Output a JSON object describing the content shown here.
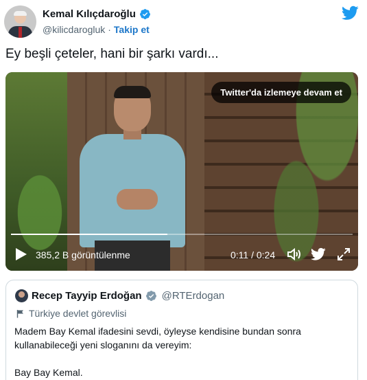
{
  "tweet": {
    "author_name": "Kemal Kılıçdaroğlu",
    "author_handle": "@kilicdarogluk",
    "separator": "·",
    "follow_label": "Takip et",
    "text": "Ey beşli çeteler, hani bir şarkı vardı..."
  },
  "video": {
    "continue_label": "Twitter'da izlemeye devam et",
    "views": "385,2 B görüntülenme",
    "time": "0:11 / 0:24",
    "progress": 0.458
  },
  "quoted": {
    "author_name": "Recep Tayyip Erdoğan",
    "author_handle": "@RTErdogan",
    "label": "Türkiye devlet görevlisi",
    "text_line1": "Madem Bay Kemal ifadesini sevdi, öyleyse kendisine bundan sonra kullanabileceği yeni sloganını da vereyim:",
    "text_line2": "Bay Bay Kemal."
  },
  "colors": {
    "twitter_blue": "#1d9bf0",
    "follow_blue": "#1d77c9",
    "secondary_text": "#536471",
    "border": "#cfd9de"
  },
  "icons": [
    "avatar",
    "verified-badge-icon",
    "twitter-logo-icon",
    "play-icon",
    "volume-icon",
    "twitter-bird-icon",
    "expand-icon",
    "government-flag-icon"
  ]
}
